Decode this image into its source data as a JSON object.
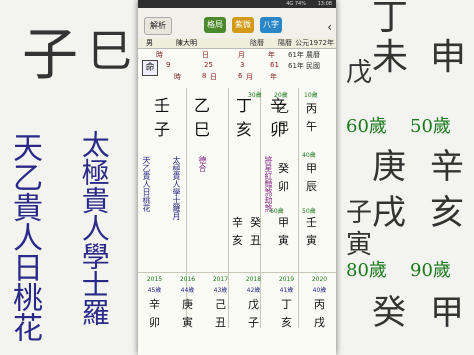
{
  "background": {
    "left_chars": [
      "子",
      "巳",
      "子"
    ],
    "left_cols": [
      "天乙貴人日桃花",
      "太極貴人學士羅"
    ],
    "right_top": [
      "丁",
      "未",
      "申"
    ],
    "right_ages": [
      "60歲",
      "50歲"
    ],
    "right_chars": [
      "辛",
      "庚",
      "戌",
      "亥",
      "甲",
      "癸"
    ],
    "right_bottom": [
      "80歲",
      "90歲"
    ],
    "right_cols": [
      "戊",
      "子",
      "寅"
    ]
  },
  "status_bar": {
    "time": "13:08",
    "signal": "4G 74%"
  },
  "app_bar": {
    "menu_label": "解析",
    "icon1_label": "格局",
    "icon2_label": "紫微",
    "icon3_label": "八字",
    "back_icon": "chevron-left"
  },
  "tabs": {
    "name": "陳大明",
    "gender": "男",
    "type": "陽曆",
    "lunar": "陰曆",
    "year": "公元1972年"
  },
  "info": {
    "row1": [
      "時",
      "日",
      "月",
      "年",
      "農曆",
      "61年"
    ],
    "row2": [
      "9",
      "25",
      "3",
      "61",
      "民國",
      "61年"
    ],
    "row3": [
      "時",
      "8",
      "日",
      "6",
      "月",
      "年"
    ]
  },
  "pillars": {
    "stems": [
      "壬",
      "乙",
      "丁",
      "辛"
    ],
    "branches": [
      "子",
      "巳",
      "亥",
      "卯"
    ],
    "badge": "命"
  },
  "stars": {
    "hour": "天乙貴人日桃花",
    "day": "太極貴人學士羅月",
    "month": "德合",
    "year": "將星紅豔煞劫煞"
  },
  "luck": {
    "header_ages": [
      "10歲",
      "20歲",
      "30歲"
    ],
    "col1": [
      "丙",
      "午"
    ],
    "col2": [
      "乙",
      "巳"
    ],
    "col3": [
      "甲",
      "辰"
    ],
    "col4": [
      "癸",
      "卯"
    ],
    "col5": [
      "壬",
      "寅"
    ],
    "age_labels": [
      "40歲",
      "50歲",
      "60歲"
    ],
    "row3_stems": [
      "甲",
      "癸",
      "辛"
    ],
    "row3_branches": [
      "寅",
      "丑",
      "亥"
    ]
  },
  "bottom": {
    "years": [
      "2015",
      "2016",
      "2017",
      "2018",
      "2019",
      "2020"
    ],
    "ages": [
      "45歲",
      "44歲",
      "43歲",
      "42歲",
      "41歲",
      "40歲"
    ],
    "stems": [
      "辛",
      "庚",
      "己",
      "戊",
      "丁",
      "丙"
    ],
    "branches": [
      "卯",
      "寅",
      "丑",
      "子",
      "亥",
      "戌"
    ]
  }
}
